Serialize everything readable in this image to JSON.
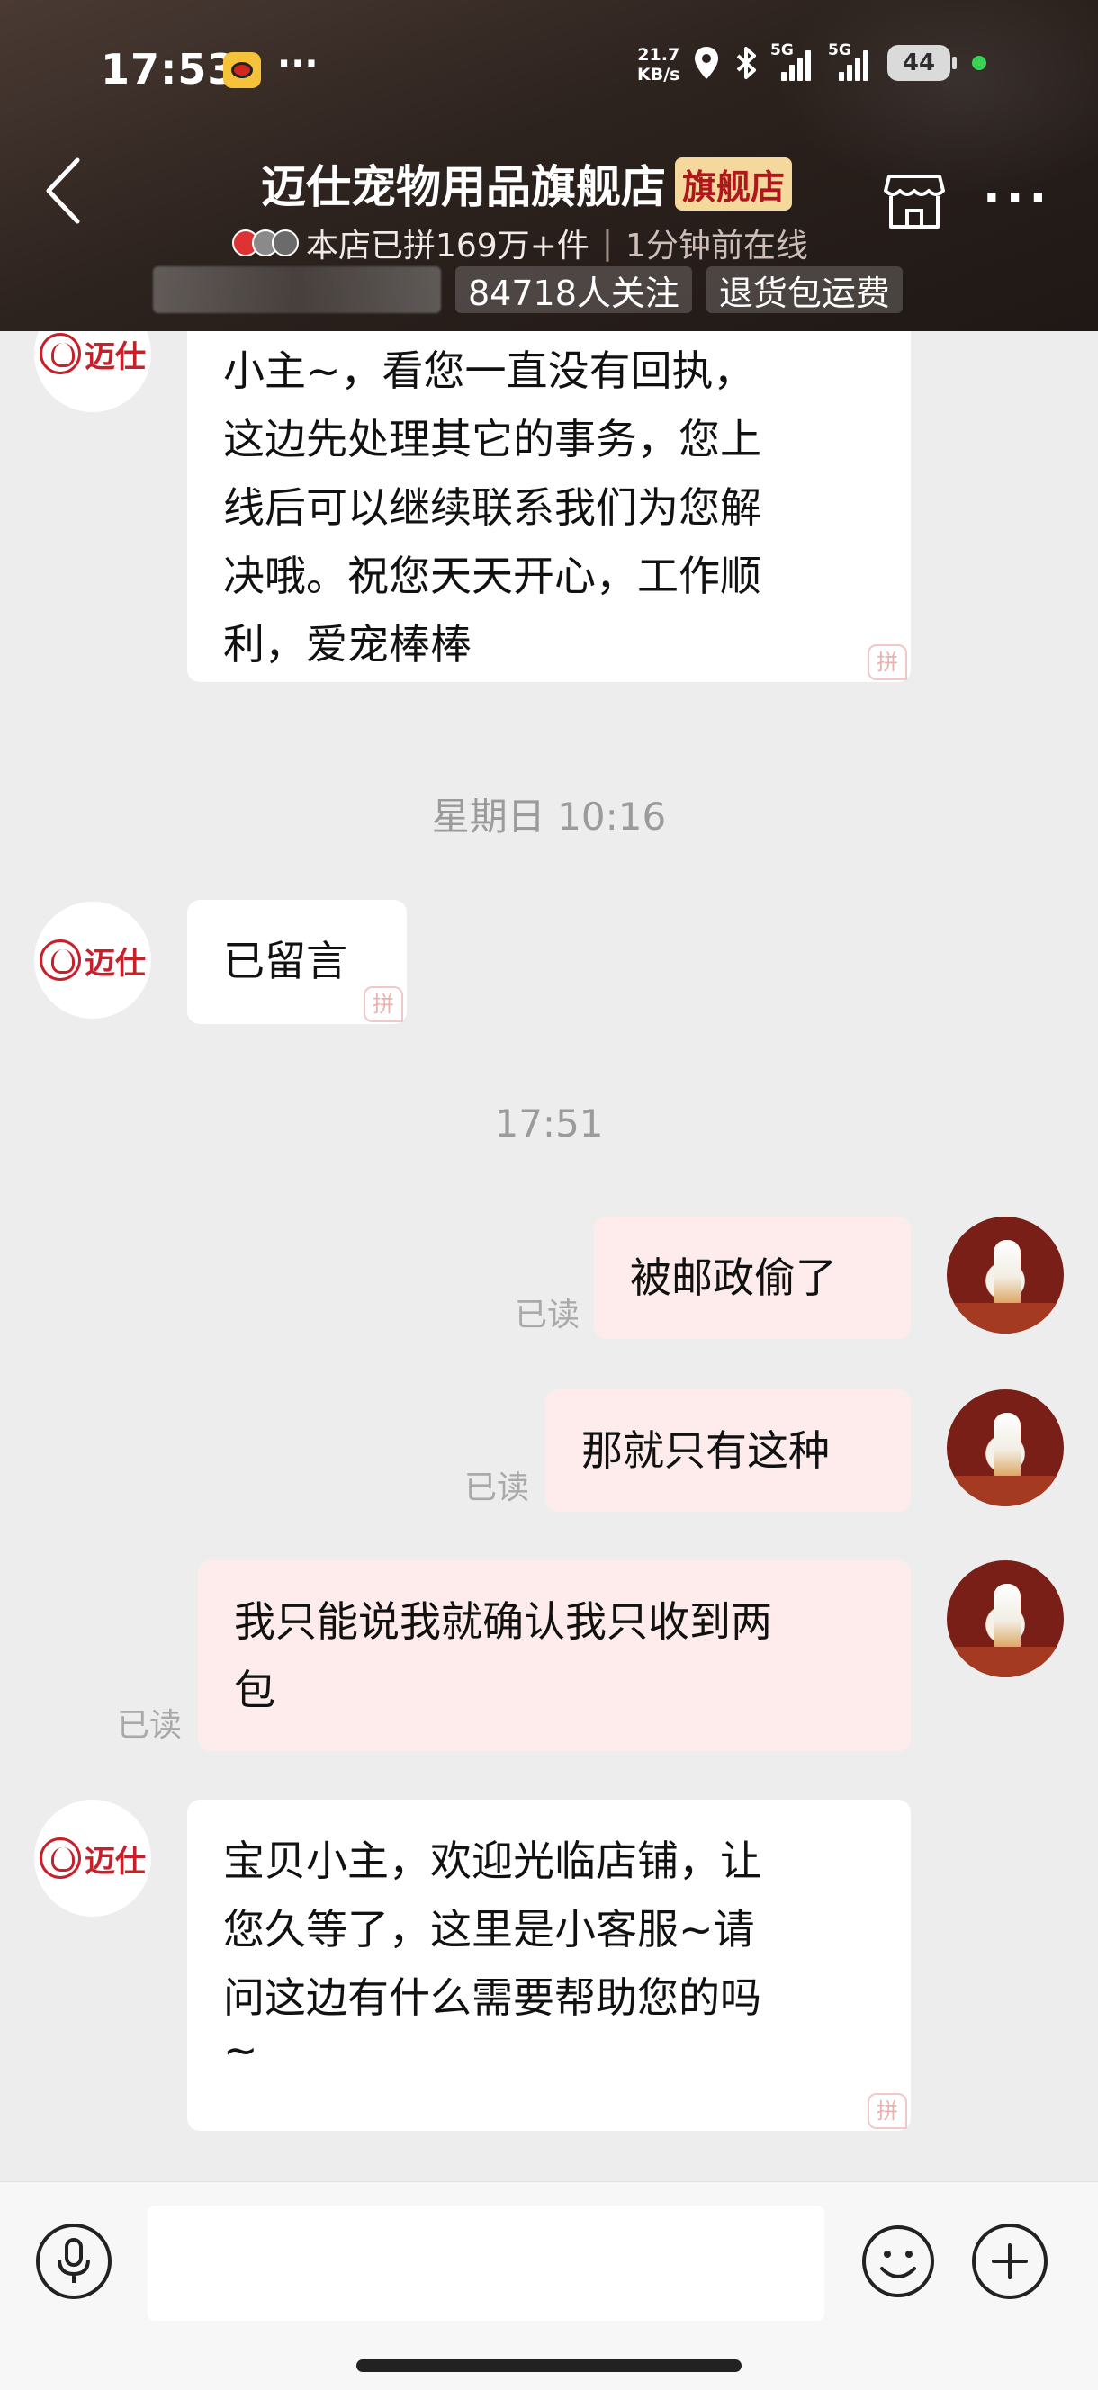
{
  "status_bar": {
    "time": "17:53",
    "dots": "···",
    "net_speed_value": "21.7",
    "net_speed_unit": "KB/s",
    "sim1": "5G",
    "sim2": "5G",
    "battery": "44"
  },
  "header": {
    "store_name": "迈仕宠物用品旗舰店",
    "badge": "旗舰店",
    "sales": "本店已拼169万+件",
    "separator": "|",
    "online": "1分钟前在线",
    "followers": "84718人关注",
    "shipping": "退货包运费"
  },
  "store_avatar": {
    "logo_text": "迈仕"
  },
  "messages": {
    "m1": {
      "lines": [
        "小主~，看您一直没有回执，",
        "这边先处理其它的事务，您上",
        "线后可以继续联系我们为您解",
        "决哦。祝您天天开心，工作顺",
        "利，爱宠棒棒"
      ]
    },
    "time1": "星期日 10:16",
    "m2": {
      "text": "已留言"
    },
    "time2": "17:51",
    "m3": {
      "text": "被邮政偷了",
      "status": "已读"
    },
    "m4": {
      "text": "那就只有这种",
      "status": "已读"
    },
    "m5": {
      "lines": [
        "我只能说我就确认我只收到两",
        "包"
      ],
      "status": "已读"
    },
    "m6": {
      "lines": [
        "宝贝小主，欢迎光临店铺，让",
        "您久等了，这里是小客服~请",
        "问这边有什么需要帮助您的吗",
        "~"
      ]
    },
    "pin_mark": "拼"
  },
  "input_bar": {
    "placeholder": ""
  },
  "colors": {
    "header_bg": "#2c221e",
    "badge_bg": "#f5d89c",
    "badge_text": "#b0171d",
    "brand_red": "#c8202a",
    "outgoing_bubble": "#fdeceb"
  }
}
